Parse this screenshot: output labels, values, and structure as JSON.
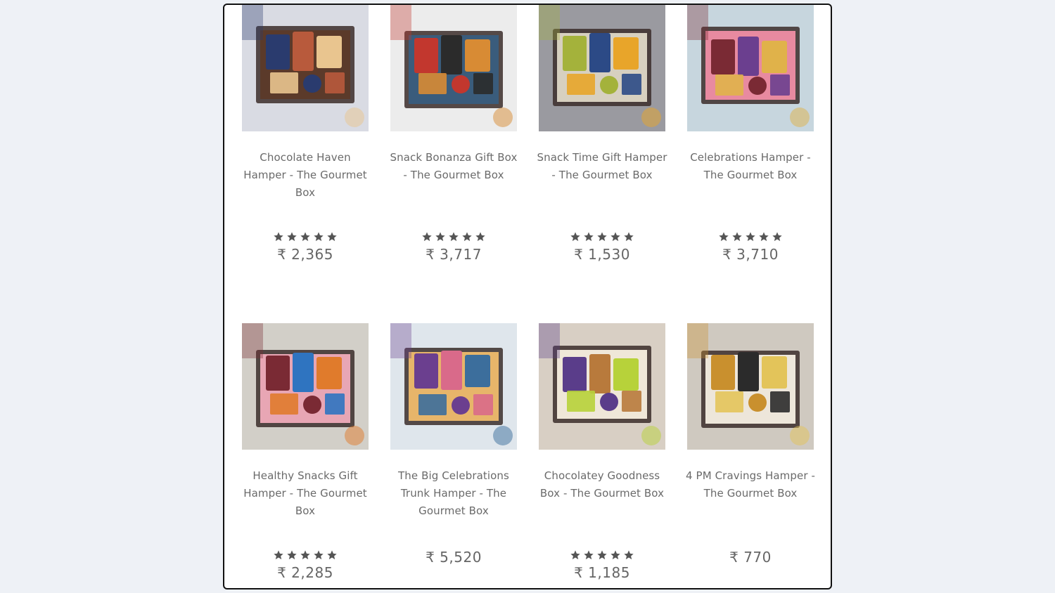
{
  "products": [
    {
      "title": "Chocolate Haven Hamper - The Gourmet Box",
      "price": "₹ 2,365",
      "rating": 5,
      "image": "chocolate-haven-hamper-photo",
      "palette": [
        "#d9dbe3",
        "#2a3b6e",
        "#b85a3c",
        "#e9c58f",
        "#5b3a2a"
      ]
    },
    {
      "title": "Snack Bonanza Gift Box - The Gourmet Box",
      "price": "₹ 3,717",
      "rating": 5,
      "image": "snack-bonanza-gift-box-photo",
      "palette": [
        "#ececec",
        "#c2372e",
        "#2b2b2b",
        "#d88b34",
        "#3a5c7c"
      ]
    },
    {
      "title": "Snack Time Gift Hamper - The Gourmet Box",
      "price": "₹ 1,530",
      "rating": 5,
      "image": "snack-time-gift-hamper-photo",
      "palette": [
        "#9a9aa0",
        "#a4b23b",
        "#2c4a86",
        "#e8a52a",
        "#d7d0c0"
      ]
    },
    {
      "title": "Celebrations Hamper - The Gourmet Box",
      "price": "₹ 3,710",
      "rating": 5,
      "image": "celebrations-hamper-photo",
      "palette": [
        "#c7d6de",
        "#7a2a34",
        "#6b3f8f",
        "#e0b24a",
        "#e88aa0"
      ]
    },
    {
      "title": "Healthy Snacks Gift Hamper - The Gourmet Box",
      "price": "₹ 2,285",
      "rating": 5,
      "image": "healthy-snacks-gift-hamper-photo",
      "palette": [
        "#d2cfc8",
        "#7a2a34",
        "#2f74c0",
        "#e07b2c",
        "#e8a6b4"
      ]
    },
    {
      "title": "The Big Celebrations Trunk Hamper - The Gourmet Box",
      "price": "₹ 5,520",
      "rating": 0,
      "image": "big-celebrations-trunk-hamper-photo",
      "palette": [
        "#dfe6ec",
        "#6b3f8f",
        "#d96a8a",
        "#3c6e9c",
        "#e7b56a"
      ]
    },
    {
      "title": "Chocolatey Goodness Box - The Gourmet Box",
      "price": "₹ 1,185",
      "rating": 5,
      "image": "chocolatey-goodness-box-photo",
      "palette": [
        "#d8cfc4",
        "#5a3d8a",
        "#b87a3c",
        "#b7d23a",
        "#efe7d8"
      ]
    },
    {
      "title": "4 PM Cravings Hamper - The Gourmet Box",
      "price": "₹ 770",
      "rating": 0,
      "image": "4pm-cravings-hamper-photo",
      "palette": [
        "#cfc9c0",
        "#c9902e",
        "#2b2b2b",
        "#e3c45a",
        "#ede6da"
      ]
    }
  ]
}
